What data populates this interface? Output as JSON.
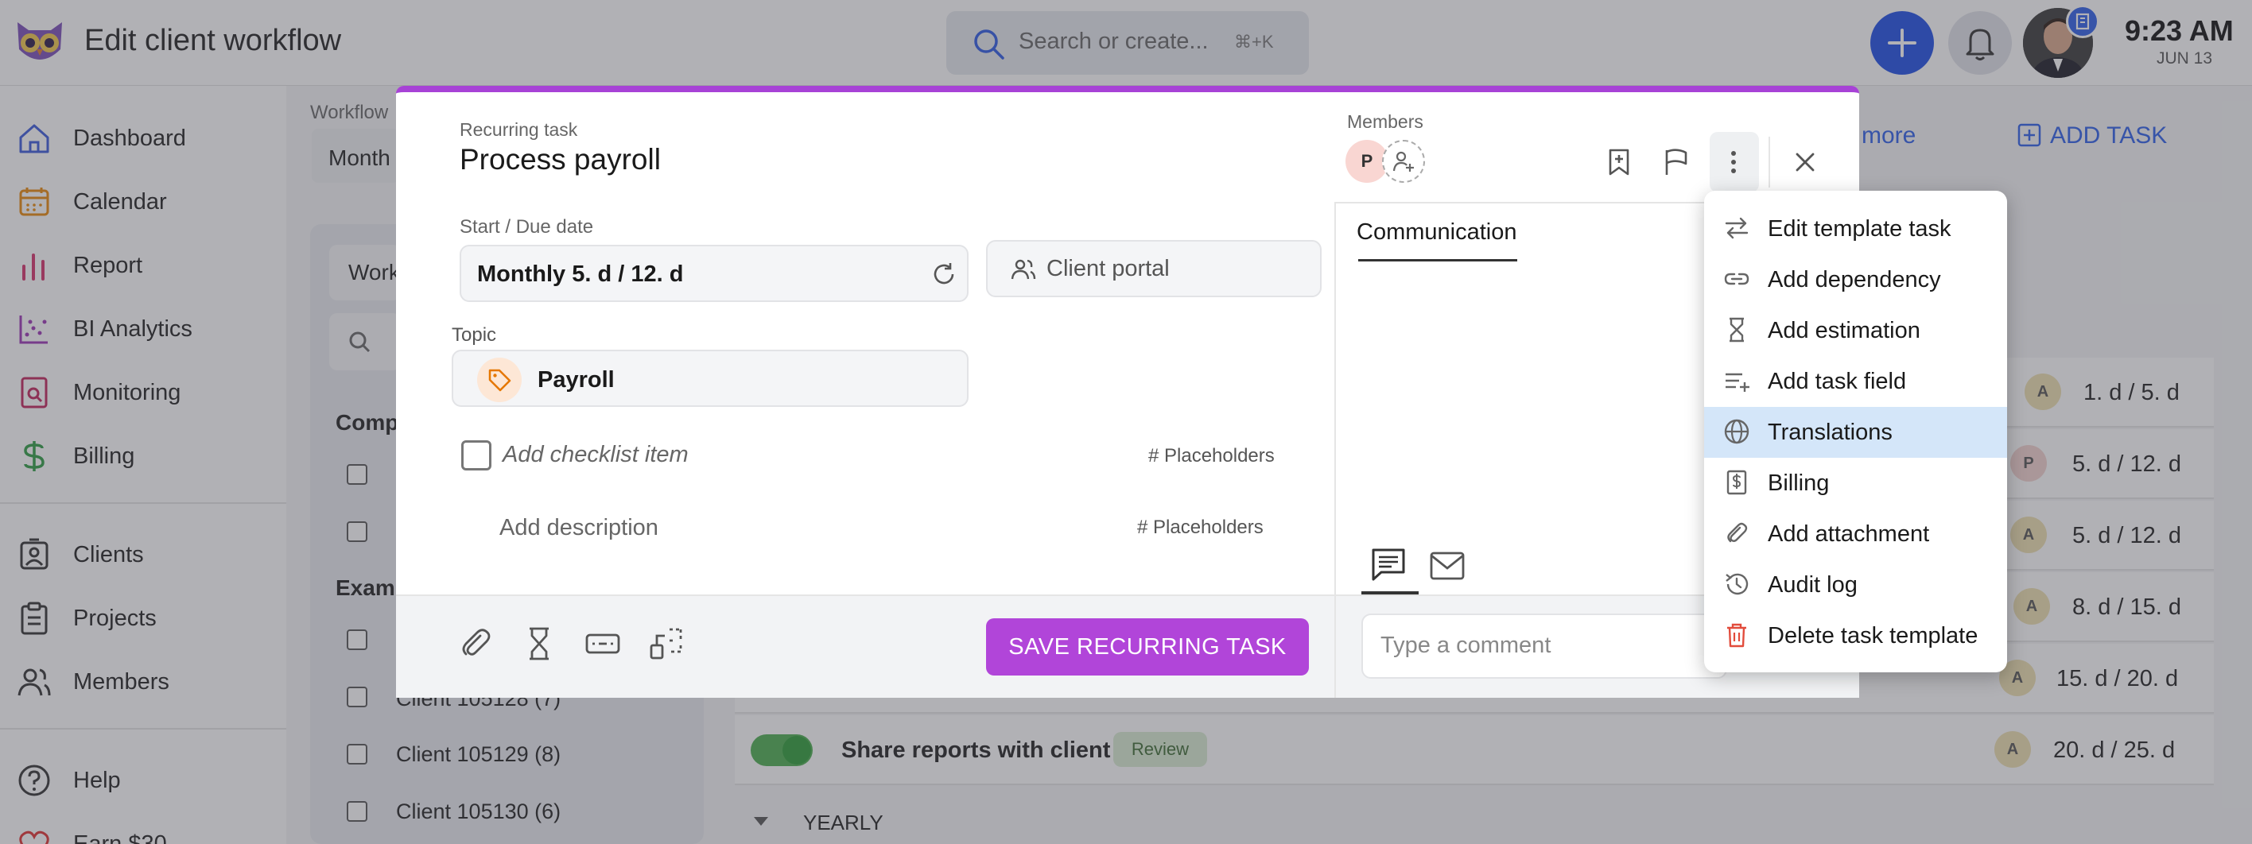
{
  "header": {
    "app_title": "Edit client workflow",
    "search_placeholder": "Search or create...",
    "search_shortcut": "⌘+K",
    "time": "9:23 AM",
    "date": "JUN 13"
  },
  "sidebar": {
    "items": [
      {
        "label": "Dashboard",
        "icon": "home-icon"
      },
      {
        "label": "Calendar",
        "icon": "calendar-icon"
      },
      {
        "label": "Report",
        "icon": "bar-chart-icon"
      },
      {
        "label": "BI Analytics",
        "icon": "scatter-chart-icon"
      },
      {
        "label": "Monitoring",
        "icon": "monitoring-icon"
      },
      {
        "label": "Billing",
        "icon": "dollar-icon"
      },
      {
        "label": "Clients",
        "icon": "client-card-icon"
      },
      {
        "label": "Projects",
        "icon": "clipboard-icon"
      },
      {
        "label": "Members",
        "icon": "people-icon"
      },
      {
        "label": "Help",
        "icon": "help-icon"
      },
      {
        "label": "Earn $30",
        "icon": "heart-icon"
      }
    ]
  },
  "background": {
    "workflow_label": "Workflow",
    "workflow_select": "Month",
    "panel_tab": "Work",
    "panel_search": "S",
    "group_company": "Comp",
    "group_example": "Exam",
    "clients": [
      "Client 105128 (7)",
      "Client 105129 (8)",
      "Client 105130 (6)"
    ],
    "learn_more": "rn more",
    "add_task": "ADD TASK",
    "rows": [
      {
        "avatar": "A",
        "dates": "1. d / 5. d"
      },
      {
        "avatar": "P",
        "dates": "5. d / 12. d"
      },
      {
        "avatar": "A",
        "dates": "5. d / 12. d"
      },
      {
        "avatar": "A",
        "dates": "8. d / 15. d"
      },
      {
        "avatar": "A",
        "dates": "15. d / 20. d"
      },
      {
        "avatar": "A",
        "dates": "20. d / 25. d"
      }
    ],
    "share_task": "Share reports with client",
    "review_badge": "Review",
    "yearly": "YEARLY"
  },
  "modal": {
    "subtitle": "Recurring task",
    "title": "Process payroll",
    "start_due_label": "Start / Due date",
    "start_due_value": "Monthly 5. d / 12. d",
    "client_portal": "Client portal",
    "topic_label": "Topic",
    "topic_value": "Payroll",
    "checklist_placeholder": "Add checklist item",
    "placeholders_label": "# Placeholders",
    "description_placeholder": "Add description",
    "members_label": "Members",
    "member_initial": "P",
    "communication_tab": "Communication",
    "save_button": "SAVE RECURRING TASK",
    "comment_placeholder": "Type a comment"
  },
  "menu": {
    "items": [
      {
        "label": "Edit template task",
        "icon": "swap-arrows-icon"
      },
      {
        "label": "Add dependency",
        "icon": "link-icon"
      },
      {
        "label": "Add estimation",
        "icon": "hourglass-icon"
      },
      {
        "label": "Add task field",
        "icon": "add-list-icon"
      },
      {
        "label": "Translations",
        "icon": "globe-icon",
        "selected": true
      },
      {
        "label": "Billing",
        "icon": "invoice-icon"
      },
      {
        "label": "Add attachment",
        "icon": "paperclip-icon"
      },
      {
        "label": "Audit log",
        "icon": "history-icon"
      },
      {
        "label": "Delete task template",
        "icon": "trash-icon"
      }
    ]
  },
  "colors": {
    "accent_purple": "#b145d9",
    "brand_blue": "#1e4fe6",
    "selected_menu": "#d4e6f9",
    "delete_red": "#e24c3c"
  }
}
